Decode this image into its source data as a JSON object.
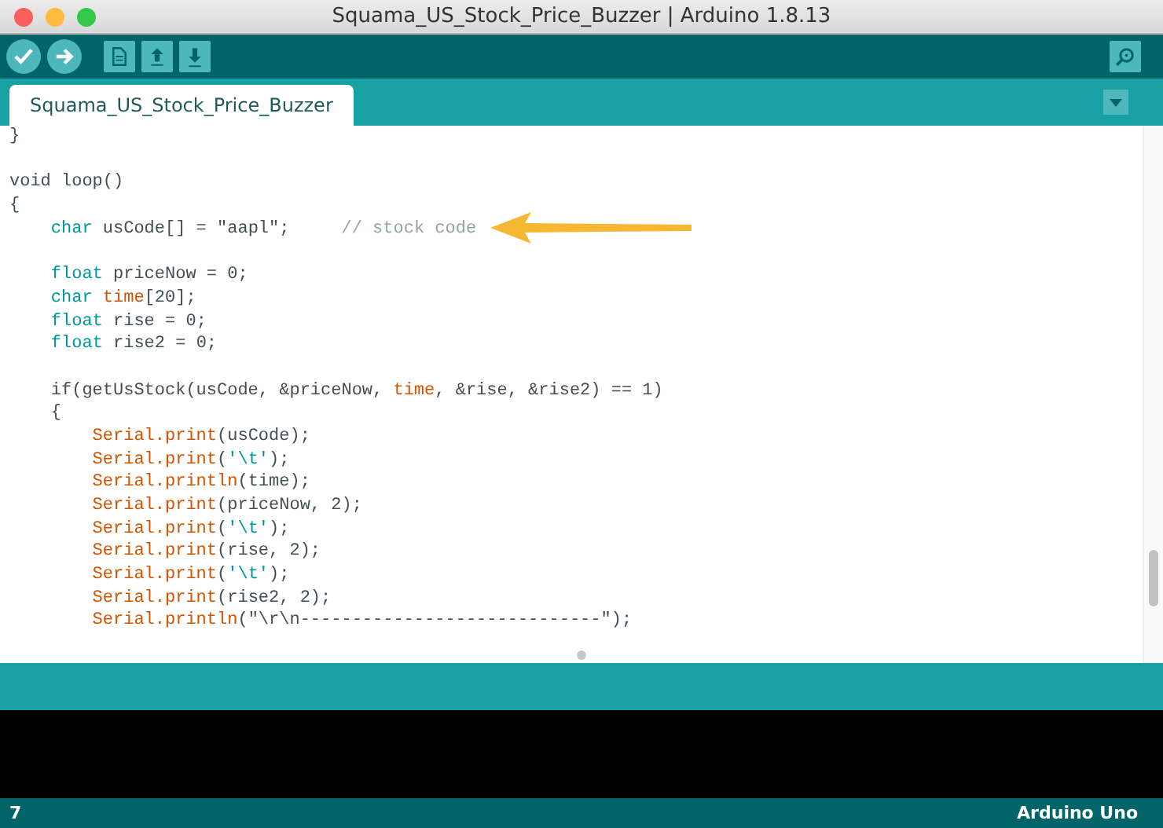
{
  "window": {
    "title": "Squama_US_Stock_Price_Buzzer | Arduino 1.8.13"
  },
  "toolbar": {
    "buttons": [
      {
        "kind": "verify"
      },
      {
        "kind": "upload"
      },
      {
        "kind": "new"
      },
      {
        "kind": "open"
      },
      {
        "kind": "save"
      }
    ]
  },
  "tabs": [
    {
      "label": "Squama_US_Stock_Price_Buzzer",
      "selected": true
    }
  ],
  "editor": {
    "lines": [
      {
        "segments": [
          {
            "t": "}",
            "kind": "plain"
          }
        ]
      },
      {
        "gap_before": true,
        "segments": [
          {
            "t": "void loop()",
            "kind": "plain"
          }
        ]
      },
      {
        "segments": [
          {
            "t": "{",
            "kind": "plain"
          }
        ],
        "children": [
          {
            "segments": [
              {
                "t": "char",
                "kind": "type"
              },
              {
                "t": " usCode[] = \"aapl\";     ",
                "kind": "plain"
              },
              {
                "t": "// stock code",
                "kind": "comment"
              }
            ]
          },
          {
            "gap_before": true,
            "segments": [
              {
                "t": "float",
                "kind": "type"
              },
              {
                "t": " priceNow = 0;",
                "kind": "plain"
              }
            ]
          },
          {
            "segments": [
              {
                "t": "char",
                "kind": "type"
              },
              {
                "t": " time",
                "kind": "func"
              },
              {
                "t": "[20];",
                "kind": "plain"
              }
            ]
          },
          {
            "segments": [
              {
                "t": "float",
                "kind": "type"
              },
              {
                "t": " rise = 0;",
                "kind": "plain"
              }
            ]
          },
          {
            "segments": [
              {
                "t": "float",
                "kind": "type"
              },
              {
                "t": " rise2 = 0;",
                "kind": "plain"
              }
            ]
          },
          {
            "gap_before": true,
            "segments": [
              {
                "t": "if(getUsStock(usCode, &priceNow, ",
                "kind": "plain"
              },
              {
                "t": "time",
                "kind": "func"
              },
              {
                "t": ", &rise, &rise2) == 1)",
                "kind": "plain"
              }
            ]
          },
          {
            "segments": [
              {
                "t": "{",
                "kind": "plain"
              }
            ],
            "children": [
              {
                "segments": [
                  {
                    "t": "Serial.print",
                    "kind": "func"
                  },
                  {
                    "t": "(usCode);",
                    "kind": "plain"
                  }
                ]
              },
              {
                "segments": [
                  {
                    "t": "Serial.print",
                    "kind": "func"
                  },
                  {
                    "t": "(",
                    "kind": "plain"
                  },
                  {
                    "t": "'\\t'",
                    "kind": "string"
                  },
                  {
                    "t": ");",
                    "kind": "plain"
                  }
                ]
              },
              {
                "segments": [
                  {
                    "t": "Serial.println",
                    "kind": "func"
                  },
                  {
                    "t": "(time);",
                    "kind": "plain"
                  }
                ]
              },
              {
                "segments": [
                  {
                    "t": "Serial.print",
                    "kind": "func"
                  },
                  {
                    "t": "(priceNow, 2);",
                    "kind": "plain"
                  }
                ]
              },
              {
                "segments": [
                  {
                    "t": "Serial.print",
                    "kind": "func"
                  },
                  {
                    "t": "(",
                    "kind": "plain"
                  },
                  {
                    "t": "'\\t'",
                    "kind": "string"
                  },
                  {
                    "t": ");",
                    "kind": "plain"
                  }
                ]
              },
              {
                "segments": [
                  {
                    "t": "Serial.print",
                    "kind": "func"
                  },
                  {
                    "t": "(rise, 2);",
                    "kind": "plain"
                  }
                ]
              },
              {
                "segments": [
                  {
                    "t": "Serial.print",
                    "kind": "func"
                  },
                  {
                    "t": "(",
                    "kind": "plain"
                  },
                  {
                    "t": "'\\t'",
                    "kind": "string"
                  },
                  {
                    "t": ");",
                    "kind": "plain"
                  }
                ]
              },
              {
                "segments": [
                  {
                    "t": "Serial.print",
                    "kind": "func"
                  },
                  {
                    "t": "(rise2, 2);",
                    "kind": "plain"
                  }
                ]
              },
              {
                "segments": [
                  {
                    "t": "Serial.println",
                    "kind": "func"
                  },
                  {
                    "t": "(\"\\r\\n-----------------------------\");",
                    "kind": "plain"
                  }
                ]
              }
            ]
          }
        ]
      }
    ]
  },
  "status_bar": {
    "line": "7",
    "board": "Arduino Uno"
  }
}
